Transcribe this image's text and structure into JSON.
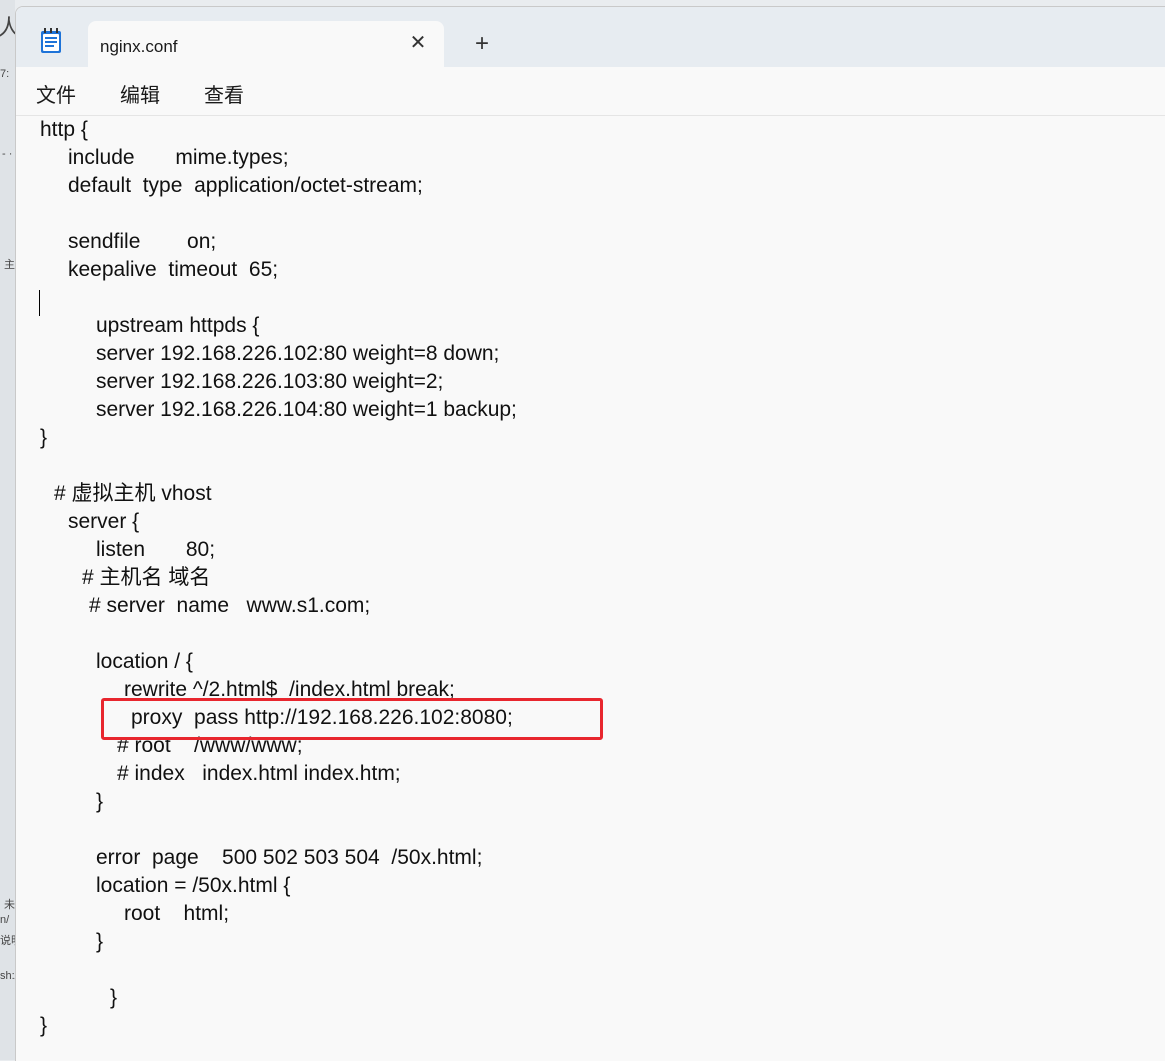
{
  "background": {
    "glyphs": [
      "人",
      "7:",
      "- ·",
      "主",
      "未",
      "n/",
      "说明",
      "sh:/"
    ]
  },
  "window": {
    "tab_title": "nginx.conf",
    "app_icon": "notepad-icon",
    "close_icon": "close-icon",
    "close_glyph": "✕",
    "new_tab_glyph": "+"
  },
  "menu": {
    "file": "文件",
    "edit": "编辑",
    "view": "查看"
  },
  "editor": {
    "lines": [
      "http {",
      "include       mime.types;",
      "default  type  application/octet-stream;",
      "sendfile        on;",
      "keepalive  timeout  65;",
      "upstream httpds {",
      "server 192.168.226.102:80 weight=8 down;",
      "server 192.168.226.103:80 weight=2;",
      "server 192.168.226.104:80 weight=1 backup;",
      "}",
      "# 虚拟主机 vhost",
      "server {",
      "listen       80;",
      "# 主机名 域名",
      "# server  name   www.s1.com;",
      "location / {",
      "rewrite ^/2.html$  /index.html break;",
      "proxy  pass http://192.168.226.102:8080;",
      "# root    /www/www;",
      "# index   index.html index.htm;",
      "}",
      "error  page    500 502 503 504  /50x.html;",
      "location = /50x.html {",
      "root    html;",
      "}",
      "}",
      "}"
    ]
  },
  "colors": {
    "highlight_border": "#e8262e",
    "editor_bg": "#f9f9f9",
    "titlebar_bg": "#e7ecf1"
  }
}
